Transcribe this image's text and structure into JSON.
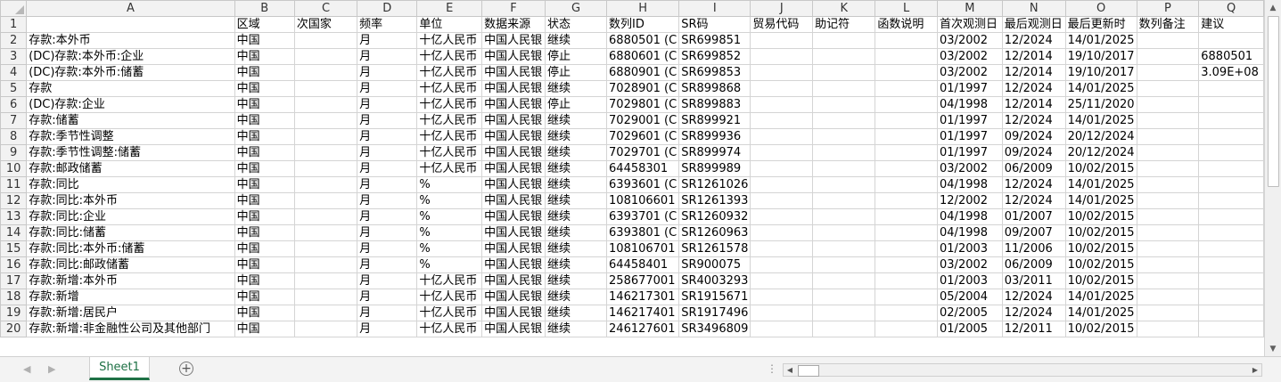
{
  "columns": [
    "A",
    "B",
    "C",
    "D",
    "E",
    "F",
    "G",
    "H",
    "I",
    "J",
    "K",
    "L",
    "M",
    "N",
    "O",
    "P",
    "Q"
  ],
  "rows": [
    {
      "n": "1",
      "cells": [
        "",
        "区域",
        "次国家",
        "频率",
        "单位",
        "数据来源",
        "状态",
        "数列ID",
        "SR码",
        "贸易代码",
        "助记符",
        "函数说明",
        "首次观测日",
        "最后观测日",
        "最后更新时",
        "数列备注",
        "建议"
      ]
    },
    {
      "n": "2",
      "cells": [
        "存款:本外币",
        "中国",
        "",
        "月",
        "十亿人民币",
        "中国人民银",
        "继续",
        "6880501 (C",
        "SR699851",
        "",
        "",
        "",
        "03/2002",
        "12/2024",
        "14/01/2025",
        "",
        ""
      ]
    },
    {
      "n": "3",
      "cells": [
        "(DC)存款:本外币:企业",
        "中国",
        "",
        "月",
        "十亿人民币",
        "中国人民银",
        "停止",
        "6880601 (C",
        "SR699852",
        "",
        "",
        "",
        "03/2002",
        "12/2014",
        "19/10/2017",
        "",
        "6880501"
      ]
    },
    {
      "n": "4",
      "cells": [
        "(DC)存款:本外币:储蓄",
        "中国",
        "",
        "月",
        "十亿人民币",
        "中国人民银",
        "停止",
        "6880901 (C",
        "SR699853",
        "",
        "",
        "",
        "03/2002",
        "12/2014",
        "19/10/2017",
        "",
        "3.09E+08"
      ]
    },
    {
      "n": "5",
      "cells": [
        "存款",
        "中国",
        "",
        "月",
        "十亿人民币",
        "中国人民银",
        "继续",
        "7028901 (C",
        "SR899868",
        "",
        "",
        "",
        "01/1997",
        "12/2024",
        "14/01/2025",
        "",
        ""
      ]
    },
    {
      "n": "6",
      "cells": [
        "(DC)存款:企业",
        "中国",
        "",
        "月",
        "十亿人民币",
        "中国人民银",
        "停止",
        "7029801 (C",
        "SR899883",
        "",
        "",
        "",
        "04/1998",
        "12/2014",
        "25/11/2020",
        "",
        ""
      ]
    },
    {
      "n": "7",
      "cells": [
        "存款:储蓄",
        "中国",
        "",
        "月",
        "十亿人民币",
        "中国人民银",
        "继续",
        "7029001 (C",
        "SR899921",
        "",
        "",
        "",
        "01/1997",
        "12/2024",
        "14/01/2025",
        "",
        ""
      ]
    },
    {
      "n": "8",
      "cells": [
        "存款:季节性调整",
        "中国",
        "",
        "月",
        "十亿人民币",
        "中国人民银",
        "继续",
        "7029601 (C",
        "SR899936",
        "",
        "",
        "",
        "01/1997",
        "09/2024",
        "20/12/2024",
        "",
        ""
      ]
    },
    {
      "n": "9",
      "cells": [
        "存款:季节性调整:储蓄",
        "中国",
        "",
        "月",
        "十亿人民币",
        "中国人民银",
        "继续",
        "7029701 (C",
        "SR899974",
        "",
        "",
        "",
        "01/1997",
        "09/2024",
        "20/12/2024",
        "",
        ""
      ]
    },
    {
      "n": "10",
      "cells": [
        "存款:邮政储蓄",
        "中国",
        "",
        "月",
        "十亿人民币",
        "中国人民银",
        "继续",
        "64458301",
        "SR899989",
        "",
        "",
        "",
        "03/2002",
        "06/2009",
        "10/02/2015",
        "",
        ""
      ]
    },
    {
      "n": "11",
      "cells": [
        "存款:同比",
        "中国",
        "",
        "月",
        "%",
        "中国人民银",
        "继续",
        "6393601 (C",
        "SR1261026",
        "",
        "",
        "",
        "04/1998",
        "12/2024",
        "14/01/2025",
        "",
        ""
      ]
    },
    {
      "n": "12",
      "cells": [
        "存款:同比:本外币",
        "中国",
        "",
        "月",
        "%",
        "中国人民银",
        "继续",
        "108106601",
        "SR1261393",
        "",
        "",
        "",
        "12/2002",
        "12/2024",
        "14/01/2025",
        "",
        ""
      ]
    },
    {
      "n": "13",
      "cells": [
        "存款:同比:企业",
        "中国",
        "",
        "月",
        "%",
        "中国人民银",
        "继续",
        "6393701 (C",
        "SR1260932",
        "",
        "",
        "",
        "04/1998",
        "01/2007",
        "10/02/2015",
        "",
        ""
      ]
    },
    {
      "n": "14",
      "cells": [
        "存款:同比:储蓄",
        "中国",
        "",
        "月",
        "%",
        "中国人民银",
        "继续",
        "6393801 (C",
        "SR1260963",
        "",
        "",
        "",
        "04/1998",
        "09/2007",
        "10/02/2015",
        "",
        ""
      ]
    },
    {
      "n": "15",
      "cells": [
        "存款:同比:本外币:储蓄",
        "中国",
        "",
        "月",
        "%",
        "中国人民银",
        "继续",
        "108106701",
        "SR1261578",
        "",
        "",
        "",
        "01/2003",
        "11/2006",
        "10/02/2015",
        "",
        ""
      ]
    },
    {
      "n": "16",
      "cells": [
        "存款:同比:邮政储蓄",
        "中国",
        "",
        "月",
        "%",
        "中国人民银",
        "继续",
        "64458401",
        "SR900075",
        "",
        "",
        "",
        "03/2002",
        "06/2009",
        "10/02/2015",
        "",
        ""
      ]
    },
    {
      "n": "17",
      "cells": [
        "存款:新增:本外币",
        "中国",
        "",
        "月",
        "十亿人民币",
        "中国人民银",
        "继续",
        "258677001",
        "SR4003293",
        "",
        "",
        "",
        "01/2003",
        "03/2011",
        "10/02/2015",
        "",
        ""
      ]
    },
    {
      "n": "18",
      "cells": [
        "存款:新增",
        "中国",
        "",
        "月",
        "十亿人民币",
        "中国人民银",
        "继续",
        "146217301",
        "SR1915671",
        "",
        "",
        "",
        "05/2004",
        "12/2024",
        "14/01/2025",
        "",
        ""
      ]
    },
    {
      "n": "19",
      "cells": [
        "存款:新增:居民户",
        "中国",
        "",
        "月",
        "十亿人民币",
        "中国人民银",
        "继续",
        "146217401",
        "SR1917496",
        "",
        "",
        "",
        "02/2005",
        "12/2024",
        "14/01/2025",
        "",
        ""
      ]
    },
    {
      "n": "20",
      "cells": [
        "存款:新增:非金融性公司及其他部门",
        "中国",
        "",
        "月",
        "十亿人民币",
        "中国人民银",
        "继续",
        "246127601",
        "SR3496809",
        "",
        "",
        "",
        "01/2005",
        "12/2011",
        "10/02/2015",
        "",
        ""
      ]
    }
  ],
  "sheet_tab": "Sheet1",
  "add_sheet_label": "+",
  "icons": {
    "tab_prev": "◀",
    "tab_next": "▶",
    "scroll_up": "▲",
    "scroll_down": "▼",
    "scroll_left": "◀",
    "scroll_right": "▶",
    "split": "⋮"
  },
  "colors": {
    "accent": "#1e7145",
    "header_bg": "#f2f2f2",
    "gridline": "#d4d4d4"
  }
}
